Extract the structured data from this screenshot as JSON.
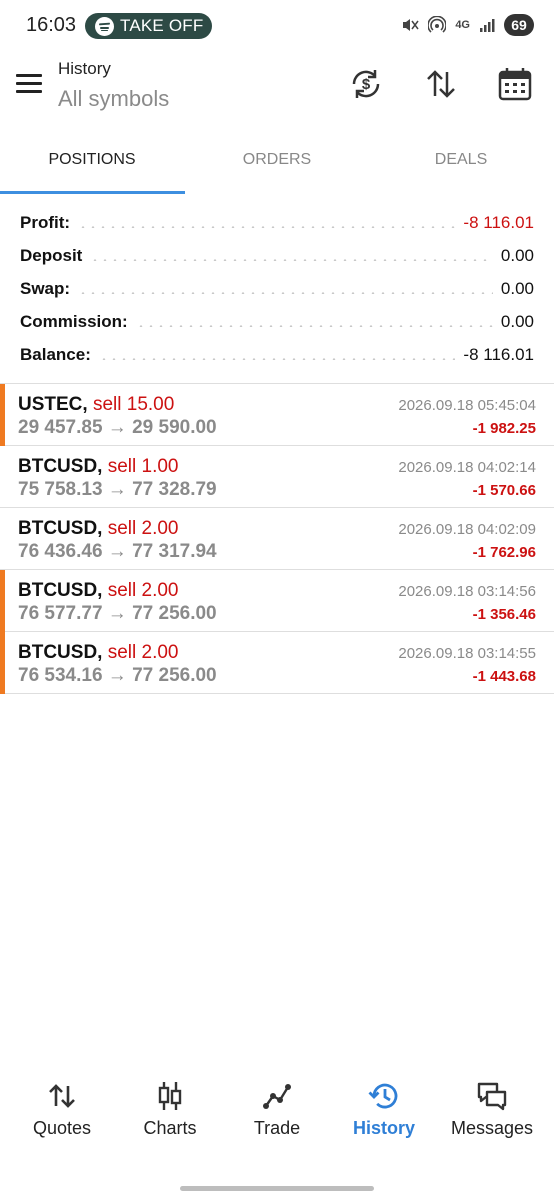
{
  "status_bar": {
    "time": "16:03",
    "media_pill": "TAKE OFF",
    "network": "4G",
    "battery": "69"
  },
  "header": {
    "title": "History",
    "subtitle": "All symbols",
    "icons": [
      "currency-refresh-icon",
      "sort-icon",
      "calendar-icon"
    ]
  },
  "tabs": [
    {
      "label": "POSITIONS",
      "active": true
    },
    {
      "label": "ORDERS",
      "active": false
    },
    {
      "label": "DEALS",
      "active": false
    }
  ],
  "summary": [
    {
      "label": "Profit:",
      "value": "-8 116.01",
      "negative": true
    },
    {
      "label": "Deposit",
      "value": "0.00",
      "negative": false
    },
    {
      "label": "Swap:",
      "value": "0.00",
      "negative": false
    },
    {
      "label": "Commission:",
      "value": "0.00",
      "negative": false
    },
    {
      "label": "Balance:",
      "value": "-8 116.01",
      "negative": false
    }
  ],
  "positions": [
    {
      "symbol": "USTEC,",
      "side": "sell 15.00",
      "prices": "29 457.85 → 29 590.00",
      "datetime": "2026.09.18 05:45:04",
      "pl": "-1 982.25",
      "marked": true
    },
    {
      "symbol": "BTCUSD,",
      "side": "sell 1.00",
      "prices": "75 758.13 → 77 328.79",
      "datetime": "2026.09.18 04:02:14",
      "pl": "-1 570.66",
      "marked": false
    },
    {
      "symbol": "BTCUSD,",
      "side": "sell 2.00",
      "prices": "76 436.46 → 77 317.94",
      "datetime": "2026.09.18 04:02:09",
      "pl": "-1 762.96",
      "marked": false
    },
    {
      "symbol": "BTCUSD,",
      "side": "sell 2.00",
      "prices": "76 577.77 → 77 256.00",
      "datetime": "2026.09.18 03:14:56",
      "pl": "-1 356.46",
      "marked": true
    },
    {
      "symbol": "BTCUSD,",
      "side": "sell 2.00",
      "prices": "76 534.16 → 77 256.00",
      "datetime": "2026.09.18 03:14:55",
      "pl": "-1 443.68",
      "marked": true
    }
  ],
  "bottom_nav": [
    {
      "label": "Quotes",
      "icon": "quotes-arrows-icon",
      "active": false
    },
    {
      "label": "Charts",
      "icon": "candlestick-icon",
      "active": false
    },
    {
      "label": "Trade",
      "icon": "trade-line-icon",
      "active": false
    },
    {
      "label": "History",
      "icon": "history-clock-icon",
      "active": true
    },
    {
      "label": "Messages",
      "icon": "messages-icon",
      "active": false
    }
  ],
  "colors": {
    "accent": "#2f7fd6",
    "negative": "#cc1111",
    "marker": "#ef7a21",
    "muted": "#8a8a8a"
  }
}
